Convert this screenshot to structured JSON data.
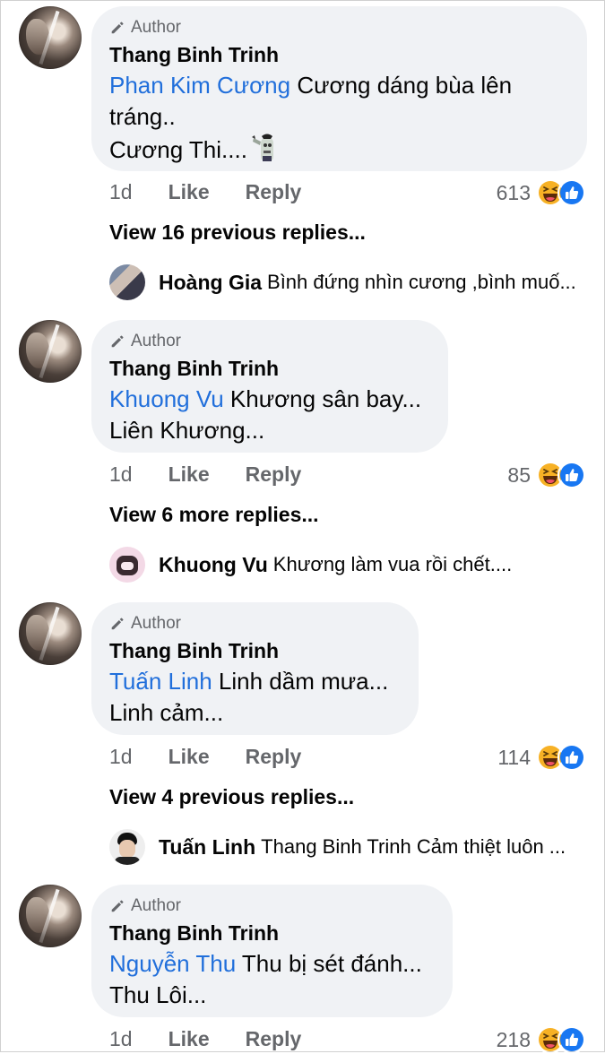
{
  "author_badge": "Author",
  "actions": {
    "like": "Like",
    "reply": "Reply"
  },
  "comments": [
    {
      "author": "Thang Binh Trinh",
      "mention": "Phan Kim Cương",
      "text_line1": " Cương dáng bùa lên",
      "text_line2": "tráng..",
      "text_line3": "Cương Thi....",
      "time": "1d",
      "reaction_count": "613",
      "more_replies": "View 16 previous replies...",
      "reply_preview": {
        "name": "Hoàng Gia",
        "text": "Bình đứng nhìn cương ,bình muố..."
      }
    },
    {
      "author": "Thang Binh Trinh",
      "mention": "Khuong Vu",
      "text_line1": " Khương sân bay...",
      "text_line2": "Liên Khương...",
      "time": "1d",
      "reaction_count": "85",
      "more_replies": "View 6 more replies...",
      "reply_preview": {
        "name": "Khuong Vu",
        "text": "Khương làm vua rồi chết...."
      }
    },
    {
      "author": "Thang Binh Trinh",
      "mention": "Tuấn Linh",
      "text_line1": " Linh dầm mưa...",
      "text_line2": "Linh cảm...",
      "time": "1d",
      "reaction_count": "114",
      "more_replies": "View 4 previous replies...",
      "reply_preview": {
        "name": "Tuấn Linh",
        "text": "Thang Binh Trinh Cảm thiệt luôn ..."
      }
    },
    {
      "author": "Thang Binh Trinh",
      "mention": "Nguyễn Thu",
      "text_line1": " Thu bị sét đánh...",
      "text_line2": "Thu Lôi...",
      "time": "1d",
      "reaction_count": "218"
    }
  ],
  "icons": {
    "pencil": "pencil-icon",
    "haha": "haha-reaction-icon",
    "like": "like-reaction-icon",
    "zombie": "zombie-emoji-icon"
  },
  "colors": {
    "mention": "#216fdb",
    "bubble": "#f0f2f5",
    "like_blue": "#1877f2",
    "haha_yellow": "#f7b125"
  }
}
